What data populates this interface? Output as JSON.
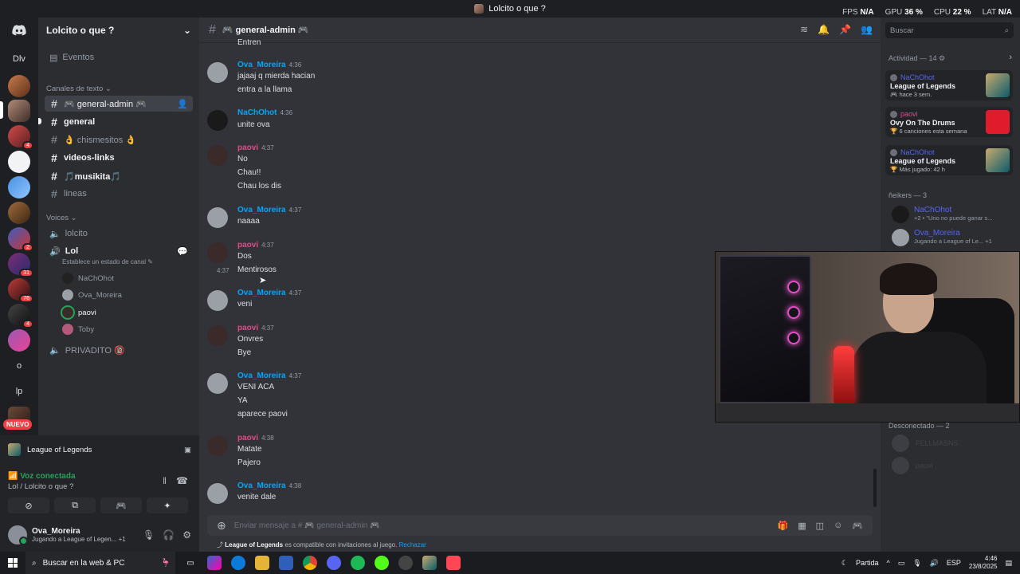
{
  "window": {
    "title": "Lolcito o que ?"
  },
  "overlay": {
    "fps_label": "FPS",
    "fps_value": "N/A",
    "gpu_label": "GPU",
    "gpu_value": "36 %",
    "cpu_label": "CPU",
    "cpu_value": "22 %",
    "lat_label": "LAT",
    "lat_value": "N/A"
  },
  "servers": {
    "dm_label": "Dlv",
    "items": [
      {
        "label": "",
        "badge": ""
      },
      {
        "label": "",
        "badge": ""
      },
      {
        "label": "",
        "badge": "4"
      },
      {
        "label": "",
        "badge": ""
      },
      {
        "label": "",
        "badge": ""
      },
      {
        "label": "",
        "badge": ""
      },
      {
        "label": "",
        "badge": "2"
      },
      {
        "label": "",
        "badge": "31"
      },
      {
        "label": "",
        "badge": "76"
      },
      {
        "label": "",
        "badge": "4"
      },
      {
        "label": "",
        "badge": ""
      }
    ],
    "text_items": [
      "o",
      "lp"
    ],
    "new_label": "NUEVO"
  },
  "sidebar": {
    "guild_name": "Lolcito o que ?",
    "events_label": "Eventos",
    "text_category": "Canales de texto",
    "text_channels": [
      {
        "name": "🎮 general-admin 🎮"
      },
      {
        "name": "general"
      },
      {
        "name": "👌 chismesitos 👌"
      },
      {
        "name": "videos-links"
      },
      {
        "name": "🎵musikita🎵"
      },
      {
        "name": "lineas"
      }
    ],
    "voice_category": "Voices",
    "voice_channels": [
      {
        "name": "lolcito"
      },
      {
        "name": "Lol",
        "status": "Establece un estado de canal"
      },
      {
        "name": "PRIVADITO 🔞"
      }
    ],
    "voice_users": [
      "NaChOhot",
      "Ova_Moreira",
      "paovi",
      "Toby"
    ]
  },
  "bottom": {
    "activity": "League of Legends",
    "voice_status": "Voz conectada",
    "voice_channel": "Lol / Lolcito o que ?",
    "user": {
      "name": "Ova_Moreira",
      "status": "Jugando a League of Legen...",
      "extra": "+1"
    }
  },
  "chat": {
    "channel": "🎮 general-admin 🎮",
    "clip_line": "Entren",
    "messages": [
      {
        "user": "Ova_Moreira",
        "color": "#00a8fc",
        "time": "4:36",
        "lines": [
          "jajaaj q mierda hacian",
          "entra a la llama"
        ]
      },
      {
        "user": "NaChOhot",
        "color": "#00a8fc",
        "time": "4:36",
        "lines": [
          "unite ova"
        ]
      },
      {
        "user": "paovi",
        "color": "#e8488a",
        "time": "4:37",
        "lines": [
          "No",
          "Chau!!",
          "Chau los dis"
        ]
      },
      {
        "user": "Ova_Moreira",
        "color": "#00a8fc",
        "time": "4:37",
        "lines": [
          "naaaa"
        ]
      },
      {
        "user": "paovi",
        "color": "#e8488a",
        "time": "4:37",
        "lines": [
          "Dos"
        ],
        "compact": [
          {
            "time": "4:37",
            "text": "Mentirosos"
          }
        ]
      },
      {
        "user": "Ova_Moreira",
        "color": "#00a8fc",
        "time": "4:37",
        "lines": [
          "veni"
        ]
      },
      {
        "user": "paovi",
        "color": "#e8488a",
        "time": "4:37",
        "lines": [
          "Onvres",
          "Bye"
        ]
      },
      {
        "user": "Ova_Moreira",
        "color": "#00a8fc",
        "time": "4:37",
        "lines": [
          "VENI ACA",
          "YA",
          "aparece paovi"
        ]
      },
      {
        "user": "paovi",
        "color": "#e8488a",
        "time": "4:38",
        "lines": [
          "Matate",
          "Pajero"
        ]
      },
      {
        "user": "Ova_Moreira",
        "color": "#00a8fc",
        "time": "4:38",
        "lines": [
          "venite dale"
        ]
      }
    ],
    "composer_placeholder": "Enviar mensaje a # 🎮 general-admin 🎮",
    "compat_game": "League of Legends",
    "compat_text": "es compatible con invitaciones al juego.",
    "compat_link": "Rechazar"
  },
  "right": {
    "search_placeholder": "Buscar",
    "activity_title": "Actividad — 14",
    "activity_cards": [
      {
        "user": "NaChOhot",
        "game": "League of Legends",
        "detail": "hace 3 sem."
      },
      {
        "user": "paovi",
        "game": "Ovy On The Drums",
        "detail": "6 canciones esta semana"
      },
      {
        "user": "NaChOhot",
        "game": "League of Legends",
        "detail": "Más jugado: 42 h"
      }
    ],
    "group_title": "ñeikers — 3",
    "members": [
      {
        "name": "NaChOhot",
        "status": "+2 • \"Uno no puede ganar s..."
      },
      {
        "name": "Ova_Moreira",
        "status": "Jugando a League of Le... +1"
      }
    ],
    "offline_title": "Desconectado — 2",
    "offline_members": [
      "FELLMASNS",
      "paovi"
    ]
  },
  "taskbar": {
    "search_placeholder": "Buscar en la web & PC",
    "weather": "Partida",
    "lang": "ESP",
    "time": "4:46",
    "date": "23/8/2025"
  },
  "colors": {
    "bg_chat": "#313338",
    "bg_sidebar": "#2b2d31",
    "accent_blue": "#00a8fc",
    "accent_pink": "#e8488a",
    "online": "#23a55a"
  }
}
